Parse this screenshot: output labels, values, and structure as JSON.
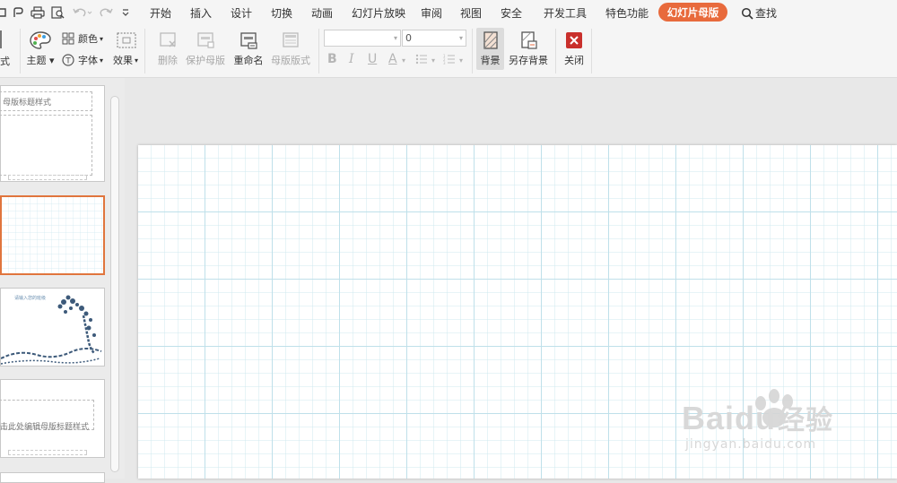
{
  "menu": {
    "tabs": [
      "开始",
      "插入",
      "设计",
      "切换",
      "动画",
      "幻灯片放映",
      "审阅",
      "视图",
      "安全",
      "开发工具",
      "特色功能"
    ],
    "active_tab": "幻灯片母版",
    "search_label": "查找"
  },
  "ribbon": {
    "partial_left_label": "式",
    "theme": "主题",
    "colors": "颜色",
    "font": "字体",
    "effects": "效果",
    "delete": "删除",
    "protect_master": "保护母版",
    "rename": "重命名",
    "master_layout": "母版版式",
    "font_size_value": "0",
    "background": "背景",
    "save_background": "另存背景",
    "close": "关闭"
  },
  "thumbnails": {
    "t1_title": "母版标题样式",
    "t3_text": "请输入您的班级",
    "t4_title": "击此处编辑母版标题样式"
  },
  "colors": {
    "accent": "#e86a3c",
    "grid": "#cfe8ef",
    "close_red": "#c9302c"
  },
  "watermark": {
    "brand": "Baidu",
    "cn": "经验",
    "url": "jingyan.baidu.com"
  }
}
